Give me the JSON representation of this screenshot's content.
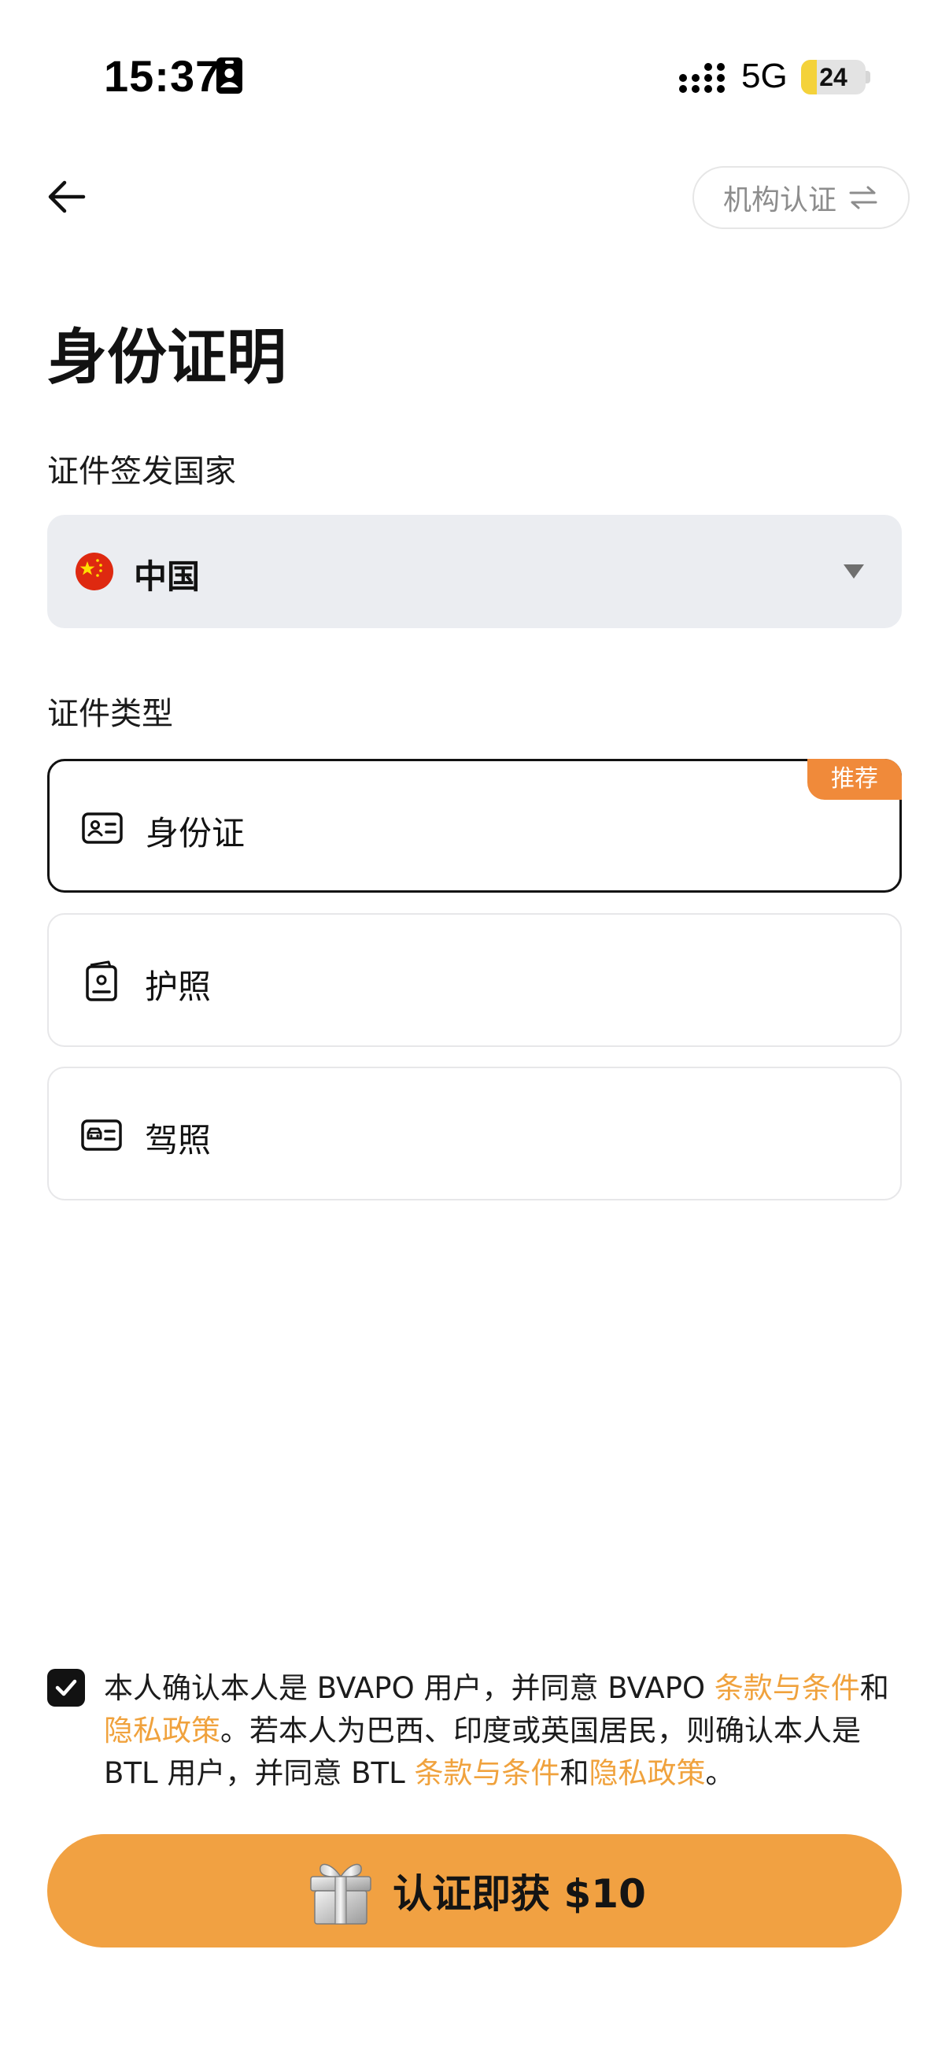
{
  "status_bar": {
    "time": "15:37",
    "network": "5G",
    "battery_level": "24",
    "battery_fraction": 0.24,
    "icons": [
      "id-badge-icon",
      "signal-icon",
      "battery-icon"
    ]
  },
  "header": {
    "back_icon": "arrow-left-icon",
    "institution_button_label": "机构认证",
    "institution_icon": "swap-arrows-icon"
  },
  "page_title": "身份证明",
  "country_section": {
    "label": "证件签发国家",
    "selected_country": "中国",
    "flag_icon": "china-flag-icon"
  },
  "doc_type_section": {
    "label": "证件类型",
    "options": [
      {
        "label": "身份证",
        "icon": "id-card-icon",
        "selected": true,
        "badge": "推荐"
      },
      {
        "label": "护照",
        "icon": "passport-icon",
        "selected": false
      },
      {
        "label": "驾照",
        "icon": "driver-license-icon",
        "selected": false
      }
    ]
  },
  "consent": {
    "checked": true,
    "part1": "本人确认本人是 BVAPO 用户，并同意 BVAPO ",
    "link1": "条款与条件",
    "and1": "和",
    "link2": "隐私政策",
    "part2": "。若本人为巴西、印度或英国居民，则确认本人是 BTL 用户，并同意 BTL ",
    "link3": "条款与条件",
    "and2": "和",
    "link4": "隐私政策",
    "end": "。"
  },
  "cta": {
    "label": "认证即获 $10",
    "icon": "gift-icon"
  },
  "colors": {
    "accent_orange": "#f1a142",
    "link_orange": "#f0a23d",
    "badge_orange": "#f08a3a",
    "select_bg": "#ebedf1",
    "battery_yellow": "#f4d23a"
  }
}
